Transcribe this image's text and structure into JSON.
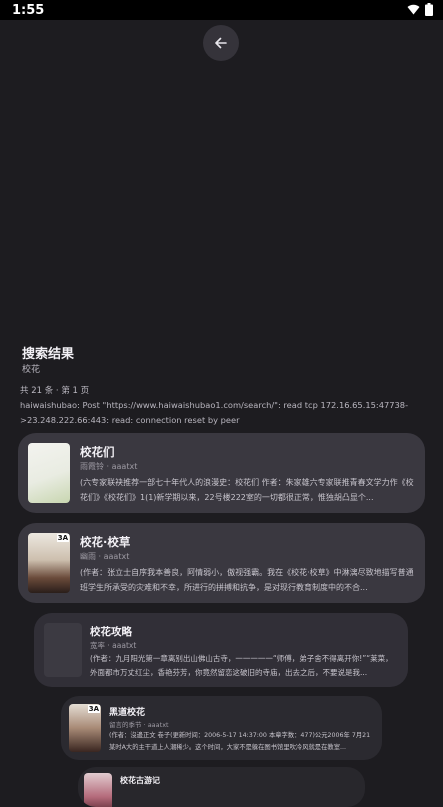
{
  "status_bar": {
    "time": "1:55"
  },
  "header": {
    "back_icon": "arrow-left-icon"
  },
  "search": {
    "title": "搜索结果",
    "keyword": "校花",
    "count_text": "共 21 条 · 第 1 页",
    "error_text": "haiwaishubao: Post \"https://www.haiwaishubao1.com/search/\": read tcp 172.16.65.15:47738->23.248.222.66:443: read: connection reset by peer"
  },
  "results": [
    {
      "name": "校花们",
      "meta": "雨霞铃 · aaatxt",
      "desc": "(六专家联袂推荐一部七十年代人的浪漫史：校花们 作者：朱家雄六专家联推青春文学力作《校花们》《校花们》1(1)新学期以来，22号楼222室的一切都很正常，惟独胡凸显个..."
    },
    {
      "name": "校花·校草",
      "meta": "幽雨 · aaatxt",
      "desc": "(作者：张立士自序我本善良，阿情弱小，傲视强霸。我在《校花·校草》中淋漓尽致地描写普通班学生所承受的灾难和不幸，所进行的拼搏和抗争，是对现行教育制度中的不合..."
    },
    {
      "name": "校花攻略",
      "meta": "宽率 · aaatxt",
      "desc": "(作者：九月阳光第一章离别出山佛山古寺，一一一一一“师傅，弟子舍不得离开你!”“莱菜，外面都市万丈红尘，香艳芬芳，你竟然留恋这破旧的寺庙，出去之后，不要说是我..."
    },
    {
      "name": "黑道校花",
      "meta": "留言的季节 · aaatxt",
      "desc": "(作者：沒邊正文 卷子(更新时间：2006-5-17 14:37:00 本章字数：477)公元2006年 7月21 某时A大的主干道上人潮稀少。这个时间，大家不是躲在图书馆里吹冷风就是在教室..."
    },
    {
      "name": "校花古游记",
      "meta": "",
      "desc": ""
    }
  ]
}
